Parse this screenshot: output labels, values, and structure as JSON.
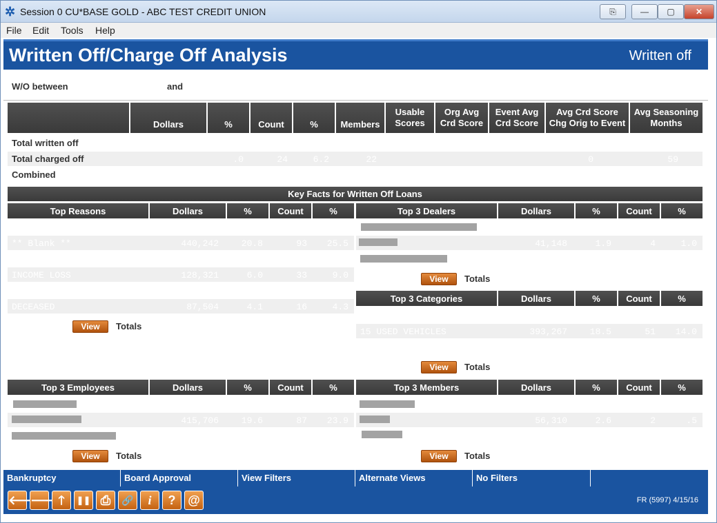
{
  "window": {
    "title": "Session 0 CU*BASE GOLD - ABC TEST CREDIT UNION",
    "extra_icon": "⎘",
    "minimize": "—",
    "maximize": "▢",
    "close": "✕"
  },
  "menu": [
    "File",
    "Edit",
    "Tools",
    "Help"
  ],
  "header": {
    "title": "Written Off/Charge Off Analysis",
    "mode": "Written off"
  },
  "filter": {
    "between_label": "W/O between",
    "and_label": "and"
  },
  "summary": {
    "columns": [
      "",
      "Dollars",
      "%",
      "Count",
      "%",
      "Members",
      "Usable\nScores",
      "Org Avg\nCrd Score",
      "Event Avg\nCrd Score",
      "Avg Crd Score\nChg Orig to Event",
      "Avg Seasoning\nMonths"
    ],
    "rows": [
      {
        "label": "Total written off",
        "values": [
          "",
          "",
          "",
          "",
          "",
          "",
          "",
          "",
          "",
          ""
        ]
      },
      {
        "label": "Total charged off",
        "values": [
          "",
          ".0",
          "24",
          "6.2",
          "22",
          "",
          "",
          "",
          "0",
          "59"
        ]
      },
      {
        "label": "Combined",
        "values": [
          "",
          "",
          "",
          "",
          "",
          "",
          "",
          "",
          "",
          ""
        ]
      }
    ]
  },
  "key_facts_title": "Key Facts for Written Off Loans",
  "top_reasons": {
    "headers": [
      "Top Reasons",
      "Dollars",
      "%",
      "Count",
      "%"
    ],
    "rows": [
      [
        "** Blank **",
        "440,242",
        "20.8",
        "93",
        "25.5"
      ],
      [
        "INCOME LOSS",
        "128,321",
        "6.0",
        "33",
        "9.0"
      ],
      [
        "DECEASED",
        "87,504",
        "4.1",
        "16",
        "4.3"
      ]
    ],
    "view": "View",
    "totals": "Totals"
  },
  "top_dealers": {
    "headers": [
      "Top 3 Dealers",
      "Dollars",
      "%",
      "Count",
      "%"
    ],
    "rows": [
      [
        "",
        "41,148",
        "1.9",
        "4",
        "1.0"
      ]
    ],
    "view": "View",
    "totals": "Totals"
  },
  "top_categories": {
    "headers": [
      "Top 3 Categories",
      "Dollars",
      "%",
      "Count",
      "%"
    ],
    "rows": [
      [
        "15 USED VEHICLES",
        "393,267",
        "18.5",
        "51",
        "14.0"
      ]
    ],
    "view": "View",
    "totals": "Totals"
  },
  "top_employees": {
    "headers": [
      "Top 3 Employees",
      "Dollars",
      "%",
      "Count",
      "%"
    ],
    "rows": [
      [
        "",
        "415,706",
        "19.6",
        "87",
        "23.9"
      ]
    ],
    "view": "View",
    "totals": "Totals"
  },
  "top_members": {
    "headers": [
      "Top 3 Members",
      "Dollars",
      "%",
      "Count",
      "%"
    ],
    "rows": [
      [
        "",
        "56,310",
        "2.6",
        "2",
        ".5"
      ]
    ],
    "view": "View",
    "totals": "Totals"
  },
  "actions": [
    "Bankruptcy",
    "Board Approval",
    "View Filters",
    "Alternate Views",
    "No Filters",
    ""
  ],
  "toolbar": {
    "icons": [
      "back-arrow-icon",
      "forward-arrow-icon",
      "up-arrow-icon",
      "pause-icon",
      "print-icon",
      "link-icon",
      "info-icon",
      "help-icon",
      "at-icon"
    ],
    "glyphs": [
      "🡐",
      "🡒",
      "🡑",
      "❚❚",
      "⎙",
      "🔗",
      "i",
      "?",
      "@"
    ]
  },
  "status_code": "FR (5997) 4/15/16"
}
